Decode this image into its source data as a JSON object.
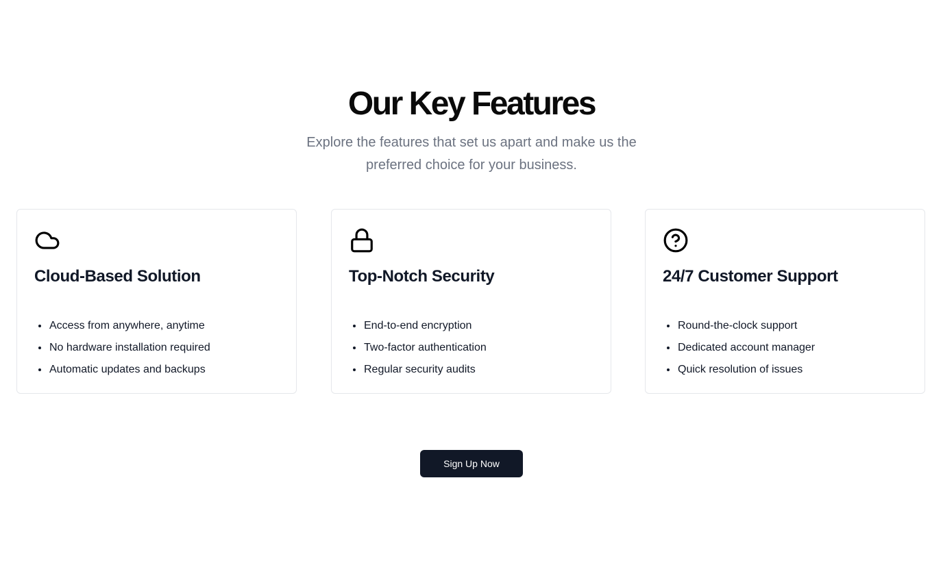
{
  "section": {
    "title": "Our Key Features",
    "subtitle": "Explore the features that set us apart and make us the preferred choice for your business."
  },
  "features": [
    {
      "icon": "cloud-icon",
      "title": "Cloud-Based Solution",
      "items": [
        "Access from anywhere, anytime",
        "No hardware installation required",
        "Automatic updates and backups"
      ]
    },
    {
      "icon": "lock-icon",
      "title": "Top-Notch Security",
      "items": [
        "End-to-end encryption",
        "Two-factor authentication",
        "Regular security audits"
      ]
    },
    {
      "icon": "help-circle-icon",
      "title": "24/7 Customer Support",
      "items": [
        "Round-the-clock support",
        "Dedicated account manager",
        "Quick resolution of issues"
      ]
    }
  ],
  "cta": {
    "label": "Sign Up Now"
  },
  "colors": {
    "heading": "#0a0a0a",
    "subtitle": "#6b7280",
    "card_border": "#e5e7eb",
    "button_bg": "#111827",
    "button_text": "#ffffff"
  }
}
